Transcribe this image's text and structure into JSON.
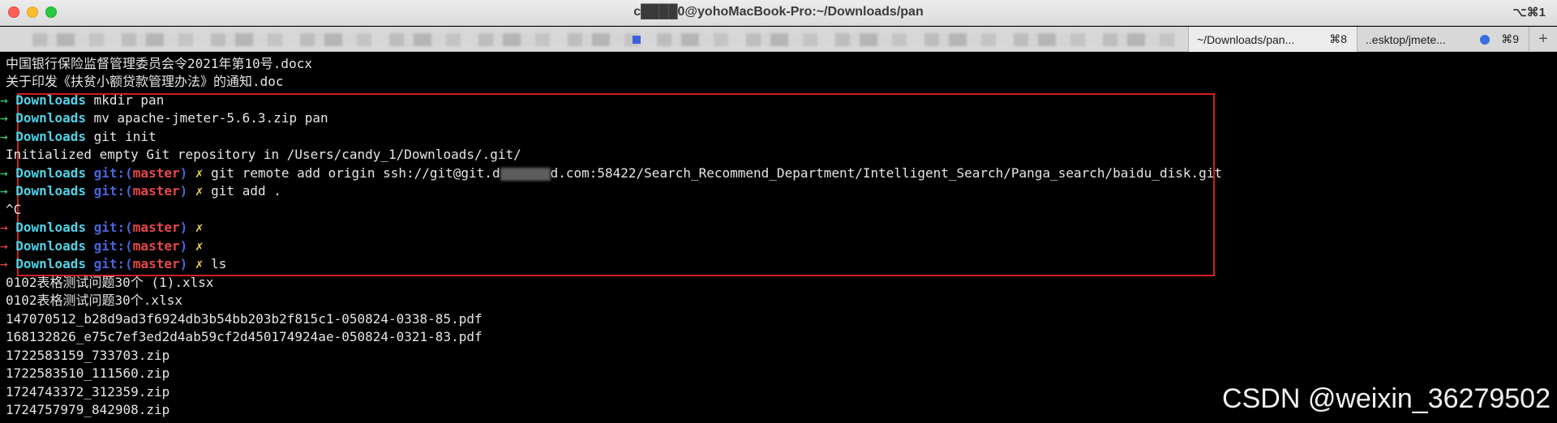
{
  "window": {
    "title": "c████0@yohoMacBook-Pro:~/Downloads/pan",
    "shortcut": "⌥⌘1"
  },
  "tabs": [
    {
      "label": "~/Downloads/pan...",
      "shortcut": "⌘8",
      "active": true
    },
    {
      "label": "..esktop/jmete...",
      "shortcut": "⌘9",
      "active": false
    }
  ],
  "new_tab_label": "+",
  "colors": {
    "prompt_ok": "#36d67a",
    "prompt_err": "#e84848",
    "dir": "#4fd4e8",
    "git": "#4a64d8",
    "branch": "#e84848",
    "dirty": "#e8d44a",
    "box": "#d11e1e"
  },
  "terminal": {
    "pre_lines": [
      "中国银行保险监督管理委员会令2021年第10号.docx",
      "关于印发《扶贫小额贷款管理办法》的通知.doc"
    ],
    "prompt_arrow": "→",
    "dir": "Downloads",
    "git_label": "git:(",
    "branch": "master",
    "git_close": ")",
    "dirty": "✗",
    "cmd1": "mkdir pan",
    "cmd2": "mv apache-jmeter-5.6.3.zip pan",
    "cmd3": "git init",
    "out_init": "Initialized empty Git repository in /Users/candy_1/Downloads/.git/",
    "cmd4_a": "git remote add origin ssh://git@git.d",
    "cmd4_b": "d.com:58422/Search_Recommend_Department/Intelligent_Search/Panga_search/baidu_disk.git",
    "cmd5": "git add .",
    "ctrl_c": "^C",
    "cmd9": "ls",
    "files": [
      "0102表格测试问题30个 (1).xlsx",
      "0102表格测试问题30个.xlsx",
      "147070512_b28d9ad3f6924db3b54bb203b2f815c1-050824-0338-85.pdf",
      "168132826_e75c7ef3ed2d4ab59cf2d450174924ae-050824-0321-83.pdf",
      "1722583159_733703.zip",
      "1722583510_111560.zip",
      "1724743372_312359.zip",
      "1724757979_842908.zip"
    ]
  },
  "watermark": "CSDN @weixin_36279502"
}
